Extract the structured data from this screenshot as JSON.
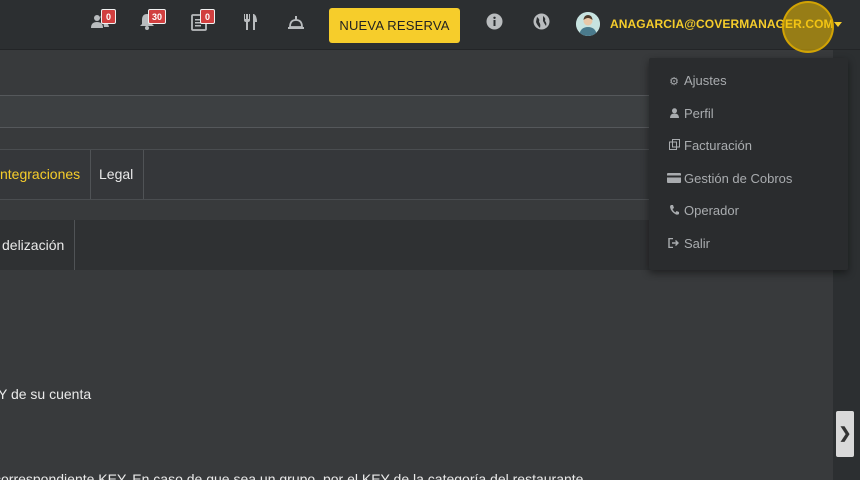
{
  "topbar": {
    "badges": {
      "groups": "0",
      "notifications": "30",
      "reservations_list": "0"
    },
    "new_reservation_label": "NUEVA RESERVA",
    "user_email": "ANAGARCIA@COVERMANAGER.COM",
    "accent_color": "#f6cd2b"
  },
  "icons": {
    "groups": "users-icon",
    "notifications": "bell-icon",
    "reservations_list": "clipboard-list-icon",
    "restaurant": "fork-knife-icon",
    "service": "hand-bell-icon",
    "info": "info-icon",
    "language": "globe-icon",
    "avatar": "avatar",
    "caret": "chevron-down-icon",
    "side_toggle": "chevron-right-icon"
  },
  "tabs": [
    {
      "label": "ntegraciones",
      "active": true
    },
    {
      "label": "Legal",
      "active": false
    }
  ],
  "subtabs": [
    {
      "label": "delización"
    }
  ],
  "content": {
    "line1": "Y de su cuenta",
    "line2": "correspondiente KEY. En caso de que sea un grupo, por el KEY de la categoría del restaurante"
  },
  "user_menu": {
    "items": [
      {
        "label": "Ajustes",
        "icon": "gear-icon"
      },
      {
        "label": "Perfil",
        "icon": "user-icon"
      },
      {
        "label": "Facturación",
        "icon": "copy-icon"
      },
      {
        "label": "Gestión de Cobros",
        "icon": "credit-card-icon"
      },
      {
        "label": "Operador",
        "icon": "phone-icon"
      },
      {
        "label": "Salir",
        "icon": "sign-out-icon"
      }
    ]
  }
}
